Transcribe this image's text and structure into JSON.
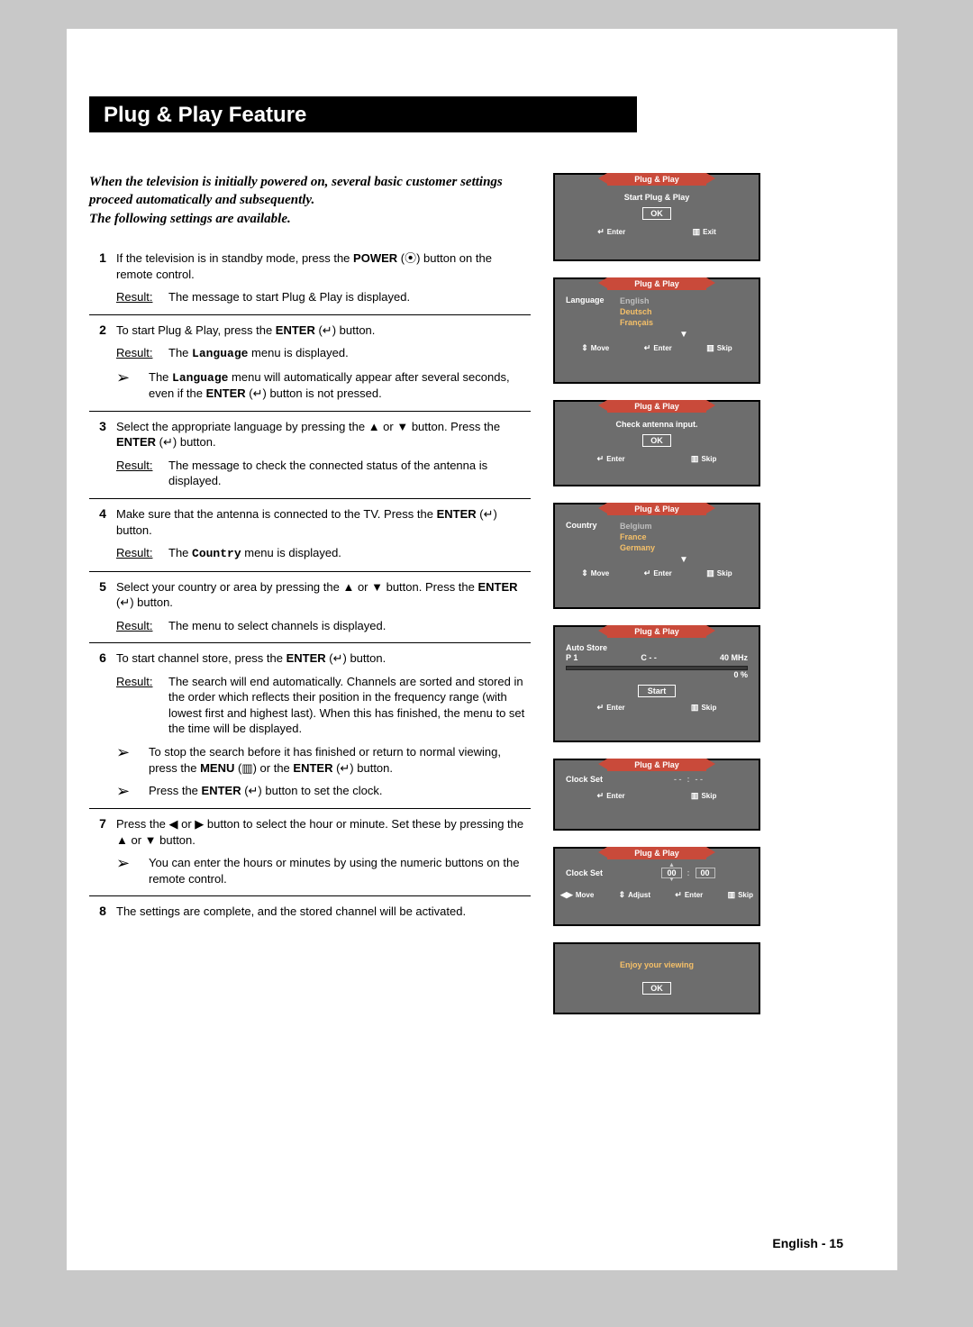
{
  "title": "Plug & Play Feature",
  "intro_lines": [
    "When the television is initially powered on, several basic customer settings proceed automatically and subsequently.",
    "The following settings are available."
  ],
  "steps": [
    {
      "num": "1",
      "paras": [
        {
          "type": "text",
          "html": "If the television is in standby mode, press the <b>POWER</b> (⦿) button on the remote control."
        },
        {
          "type": "result",
          "text": "The message to start Plug & Play is displayed."
        }
      ]
    },
    {
      "num": "2",
      "paras": [
        {
          "type": "text",
          "html": "To start Plug & Play, press the <b>ENTER</b> (↵) button."
        },
        {
          "type": "result",
          "html": "The <b class='mono'>Language</b> menu is displayed."
        },
        {
          "type": "note",
          "html": "The <b class='mono'>Language</b> menu will automatically appear after several seconds, even if the <b>ENTER</b> (↵) button is not pressed."
        }
      ]
    },
    {
      "num": "3",
      "paras": [
        {
          "type": "text",
          "html": "Select the appropriate language by pressing the ▲ or ▼ button. Press the <b>ENTER</b> (↵) button."
        },
        {
          "type": "result",
          "text": "The message to check the connected status of the antenna is displayed."
        }
      ]
    },
    {
      "num": "4",
      "paras": [
        {
          "type": "text",
          "html": "Make sure that the antenna is connected to the TV. Press the <b>ENTER</b> (↵) button."
        },
        {
          "type": "result",
          "html": "The <b class='mono'>Country</b> menu is displayed."
        }
      ]
    },
    {
      "num": "5",
      "paras": [
        {
          "type": "text",
          "html": "Select your country or area by pressing the ▲ or ▼ button. Press the <b>ENTER</b> (↵) button."
        },
        {
          "type": "result",
          "text": "The menu to select channels is displayed."
        }
      ]
    },
    {
      "num": "6",
      "paras": [
        {
          "type": "text",
          "html": "To start channel store, press the <b>ENTER</b> (↵) button."
        },
        {
          "type": "result",
          "text": "The search will end automatically. Channels are sorted and stored in the order which reflects their position in the frequency range (with lowest first and highest last). When this has finished, the menu to set the time will be displayed."
        },
        {
          "type": "note",
          "html": "To stop the search before it has finished or return to normal viewing, press the <b>MENU</b> (▥) or the <b>ENTER</b> (↵) button."
        },
        {
          "type": "note",
          "html": "Press the <b>ENTER</b> (↵) button to set the clock."
        }
      ]
    },
    {
      "num": "7",
      "paras": [
        {
          "type": "text",
          "html": "Press the ◀ or ▶ button to select the hour or minute. Set these by pressing the ▲ or ▼ button."
        },
        {
          "type": "note",
          "html": "You can enter the hours or minutes by using the numeric buttons on the remote control."
        }
      ]
    },
    {
      "num": "8",
      "paras": [
        {
          "type": "text",
          "html": "The settings are complete, and the stored channel will be activated."
        }
      ]
    }
  ],
  "osd": {
    "tab": "Plug & Play",
    "start_msg": "Start Plug & Play",
    "ok": "OK",
    "enter": "Enter",
    "exit": "Exit",
    "move": "Move",
    "skip": "Skip",
    "adjust": "Adjust",
    "language_label": "Language",
    "languages": [
      "English",
      "Deutsch",
      "Français"
    ],
    "antenna_msg": "Check antenna input.",
    "country_label": "Country",
    "countries": [
      "Belgium",
      "France",
      "Germany"
    ],
    "auto_store": "Auto Store",
    "auto_p": "P   1",
    "auto_c": "C   - -",
    "auto_freq": "40 MHz",
    "auto_pct": "0 %",
    "start": "Start",
    "clock_set": "Clock Set",
    "clock_dash": "- -",
    "clock_zero": "00",
    "enjoy": "Enjoy your viewing"
  },
  "page_footer": "English - 15"
}
